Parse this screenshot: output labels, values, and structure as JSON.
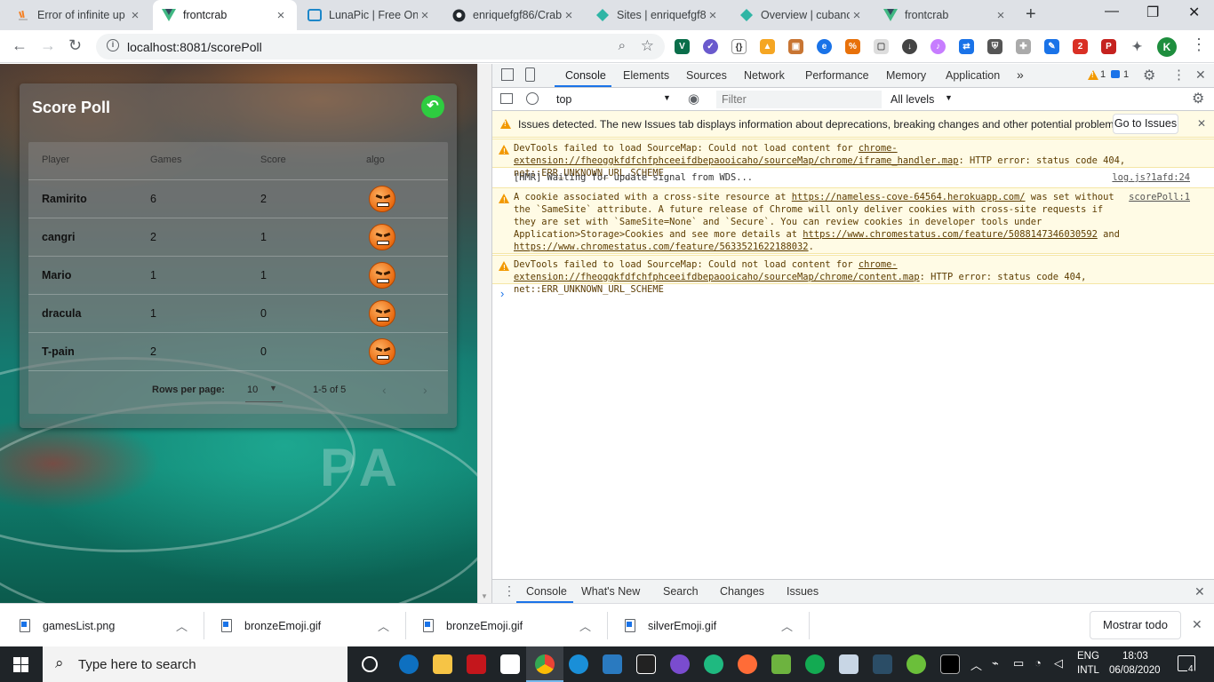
{
  "browser": {
    "tabs": [
      {
        "title": "Error of infinite up",
        "icon": "stackoverflow-icon"
      },
      {
        "title": "frontcrab",
        "icon": "vue-icon",
        "active": true
      },
      {
        "title": "LunaPic | Free Onli",
        "icon": "lunapic-icon"
      },
      {
        "title": "enriquefgf86/Crab",
        "icon": "github-icon"
      },
      {
        "title": "Sites | enriquefgf8",
        "icon": "netlify-icon"
      },
      {
        "title": "Overview | cubanc",
        "icon": "netlify-icon"
      },
      {
        "title": "frontcrab",
        "icon": "vue-icon"
      }
    ],
    "url": "localhost:8081/scorePoll",
    "profile_initial": "K"
  },
  "app": {
    "title": "Score Poll",
    "columns": [
      "Player",
      "Games",
      "Score",
      "algo"
    ],
    "rows": [
      {
        "player": "Ramirito",
        "games": "6",
        "score": "2"
      },
      {
        "player": "cangri",
        "games": "2",
        "score": "1"
      },
      {
        "player": "Mario",
        "games": "1",
        "score": "1"
      },
      {
        "player": "dracula",
        "games": "1",
        "score": "0"
      },
      {
        "player": "T-pain",
        "games": "2",
        "score": "0"
      }
    ],
    "rows_per_page_label": "Rows per page:",
    "rows_per_page_value": "10",
    "range": "1-5 of 5"
  },
  "devtools": {
    "tabs": [
      "Console",
      "Elements",
      "Sources",
      "Network",
      "Performance",
      "Memory",
      "Application"
    ],
    "warn_count": "1",
    "info_count": "1",
    "context": "top",
    "filter_placeholder": "Filter",
    "levels": "All levels",
    "issues_text": "Issues detected. The new Issues tab displays information about deprecations, breaking changes and other potential problems.",
    "issues_button": "Go to Issues",
    "messages": [
      {
        "type": "warn",
        "text": "DevTools failed to load SourceMap: Could not load content for ",
        "link": "chrome-extension://fheoggkfdfchfphceeifdbepaooicaho/sourceMap/chrome/iframe_handler.map",
        "rest": ": HTTP error: status code 404, net::ERR_UNKNOWN_URL_SCHEME"
      },
      {
        "type": "log",
        "text": "[HMR] Waiting for update signal from WDS...",
        "source": "log.js?1afd:24"
      },
      {
        "type": "warn",
        "text_1": "A cookie associated with a cross-site resource at ",
        "link_1": "https://nameless-cove-64564.herokuapp.com/",
        "text_2": " was set without the `SameSite` attribute. A future release of Chrome will only deliver cookies with cross-site requests if they are set with `SameSite=None` and `Secure`. You can review cookies in developer tools under Application>Storage>Cookies and see more details at ",
        "link_2": "https://www.chromestatus.com/feature/5088147346030592",
        "text_3": " and ",
        "link_3": "https://www.chromestatus.com/feature/5633521622188032",
        "text_4": ".",
        "source": "scorePoll:1"
      },
      {
        "type": "warn",
        "text": "DevTools failed to load SourceMap: Could not load content for ",
        "link": "chrome-extension://fheoggkfdfchfphceeifdbepaooicaho/sourceMap/chrome/content.map",
        "rest": ": HTTP error: status code 404, net::ERR_UNKNOWN_URL_SCHEME"
      }
    ],
    "drawer_tabs": [
      "Console",
      "What's New",
      "Search",
      "Changes",
      "Issues"
    ]
  },
  "downloads": {
    "items": [
      "gamesList.png",
      "bronzeEmoji.gif",
      "bronzeEmoji.gif",
      "silverEmoji.gif"
    ],
    "show_all": "Mostrar todo"
  },
  "taskbar": {
    "search_placeholder": "Type here to search",
    "lang_1": "ENG",
    "lang_2": "INTL",
    "time": "18:03",
    "date": "06/08/2020",
    "notifications": "4"
  }
}
